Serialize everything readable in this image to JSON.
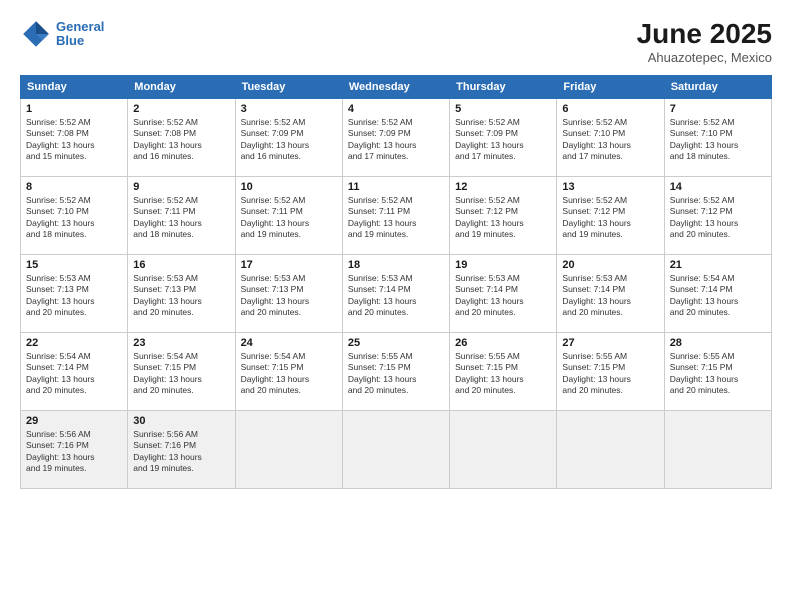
{
  "logo": {
    "line1": "General",
    "line2": "Blue"
  },
  "title": "June 2025",
  "subtitle": "Ahuazotepec, Mexico",
  "days_of_week": [
    "Sunday",
    "Monday",
    "Tuesday",
    "Wednesday",
    "Thursday",
    "Friday",
    "Saturday"
  ],
  "weeks": [
    [
      {
        "day": "1",
        "info": "Sunrise: 5:52 AM\nSunset: 7:08 PM\nDaylight: 13 hours\nand 15 minutes."
      },
      {
        "day": "2",
        "info": "Sunrise: 5:52 AM\nSunset: 7:08 PM\nDaylight: 13 hours\nand 16 minutes."
      },
      {
        "day": "3",
        "info": "Sunrise: 5:52 AM\nSunset: 7:09 PM\nDaylight: 13 hours\nand 16 minutes."
      },
      {
        "day": "4",
        "info": "Sunrise: 5:52 AM\nSunset: 7:09 PM\nDaylight: 13 hours\nand 17 minutes."
      },
      {
        "day": "5",
        "info": "Sunrise: 5:52 AM\nSunset: 7:09 PM\nDaylight: 13 hours\nand 17 minutes."
      },
      {
        "day": "6",
        "info": "Sunrise: 5:52 AM\nSunset: 7:10 PM\nDaylight: 13 hours\nand 17 minutes."
      },
      {
        "day": "7",
        "info": "Sunrise: 5:52 AM\nSunset: 7:10 PM\nDaylight: 13 hours\nand 18 minutes."
      }
    ],
    [
      {
        "day": "8",
        "info": "Sunrise: 5:52 AM\nSunset: 7:10 PM\nDaylight: 13 hours\nand 18 minutes."
      },
      {
        "day": "9",
        "info": "Sunrise: 5:52 AM\nSunset: 7:11 PM\nDaylight: 13 hours\nand 18 minutes."
      },
      {
        "day": "10",
        "info": "Sunrise: 5:52 AM\nSunset: 7:11 PM\nDaylight: 13 hours\nand 19 minutes."
      },
      {
        "day": "11",
        "info": "Sunrise: 5:52 AM\nSunset: 7:11 PM\nDaylight: 13 hours\nand 19 minutes."
      },
      {
        "day": "12",
        "info": "Sunrise: 5:52 AM\nSunset: 7:12 PM\nDaylight: 13 hours\nand 19 minutes."
      },
      {
        "day": "13",
        "info": "Sunrise: 5:52 AM\nSunset: 7:12 PM\nDaylight: 13 hours\nand 19 minutes."
      },
      {
        "day": "14",
        "info": "Sunrise: 5:52 AM\nSunset: 7:12 PM\nDaylight: 13 hours\nand 20 minutes."
      }
    ],
    [
      {
        "day": "15",
        "info": "Sunrise: 5:53 AM\nSunset: 7:13 PM\nDaylight: 13 hours\nand 20 minutes."
      },
      {
        "day": "16",
        "info": "Sunrise: 5:53 AM\nSunset: 7:13 PM\nDaylight: 13 hours\nand 20 minutes."
      },
      {
        "day": "17",
        "info": "Sunrise: 5:53 AM\nSunset: 7:13 PM\nDaylight: 13 hours\nand 20 minutes."
      },
      {
        "day": "18",
        "info": "Sunrise: 5:53 AM\nSunset: 7:14 PM\nDaylight: 13 hours\nand 20 minutes."
      },
      {
        "day": "19",
        "info": "Sunrise: 5:53 AM\nSunset: 7:14 PM\nDaylight: 13 hours\nand 20 minutes."
      },
      {
        "day": "20",
        "info": "Sunrise: 5:53 AM\nSunset: 7:14 PM\nDaylight: 13 hours\nand 20 minutes."
      },
      {
        "day": "21",
        "info": "Sunrise: 5:54 AM\nSunset: 7:14 PM\nDaylight: 13 hours\nand 20 minutes."
      }
    ],
    [
      {
        "day": "22",
        "info": "Sunrise: 5:54 AM\nSunset: 7:14 PM\nDaylight: 13 hours\nand 20 minutes."
      },
      {
        "day": "23",
        "info": "Sunrise: 5:54 AM\nSunset: 7:15 PM\nDaylight: 13 hours\nand 20 minutes."
      },
      {
        "day": "24",
        "info": "Sunrise: 5:54 AM\nSunset: 7:15 PM\nDaylight: 13 hours\nand 20 minutes."
      },
      {
        "day": "25",
        "info": "Sunrise: 5:55 AM\nSunset: 7:15 PM\nDaylight: 13 hours\nand 20 minutes."
      },
      {
        "day": "26",
        "info": "Sunrise: 5:55 AM\nSunset: 7:15 PM\nDaylight: 13 hours\nand 20 minutes."
      },
      {
        "day": "27",
        "info": "Sunrise: 5:55 AM\nSunset: 7:15 PM\nDaylight: 13 hours\nand 20 minutes."
      },
      {
        "day": "28",
        "info": "Sunrise: 5:55 AM\nSunset: 7:15 PM\nDaylight: 13 hours\nand 20 minutes."
      }
    ],
    [
      {
        "day": "29",
        "info": "Sunrise: 5:56 AM\nSunset: 7:16 PM\nDaylight: 13 hours\nand 19 minutes."
      },
      {
        "day": "30",
        "info": "Sunrise: 5:56 AM\nSunset: 7:16 PM\nDaylight: 13 hours\nand 19 minutes."
      },
      {
        "day": "",
        "info": ""
      },
      {
        "day": "",
        "info": ""
      },
      {
        "day": "",
        "info": ""
      },
      {
        "day": "",
        "info": ""
      },
      {
        "day": "",
        "info": ""
      }
    ]
  ]
}
